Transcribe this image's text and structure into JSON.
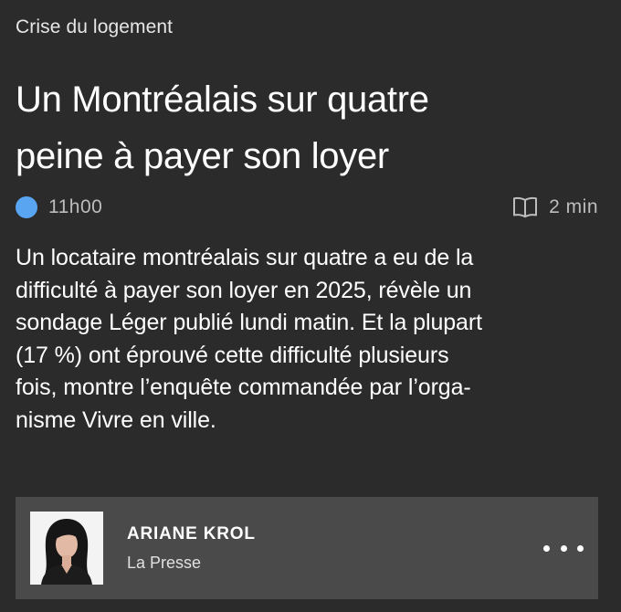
{
  "article": {
    "category": "Crise du logement",
    "headline_lines": [
      "Un Montréalais sur quatre",
      "peine à payer son loyer"
    ],
    "time": "11h00",
    "reading_time": "2 min",
    "lede": "Un locataire montréalais sur quatre a eu de la\ndifficulté à payer son loyer en 2025, révèle un\nsondage Léger publié lundi matin. Et la plupart\n(17 %) ont éprouvé cette difficulté plusieurs\nfois, montre l’enquête commandée par l’orga-\nnisme Vivre en ville."
  },
  "author": {
    "name": "ARIANE KROL",
    "outlet": "La Presse"
  },
  "icons": {
    "status_dot": "status-dot-icon",
    "reading_time": "open-book-icon",
    "more": "more-dots-icon"
  },
  "colors": {
    "background": "#2b2b2b",
    "card": "#4a4a4a",
    "accent_dot": "#5aa5f2",
    "muted_text": "#bdbdbd"
  }
}
